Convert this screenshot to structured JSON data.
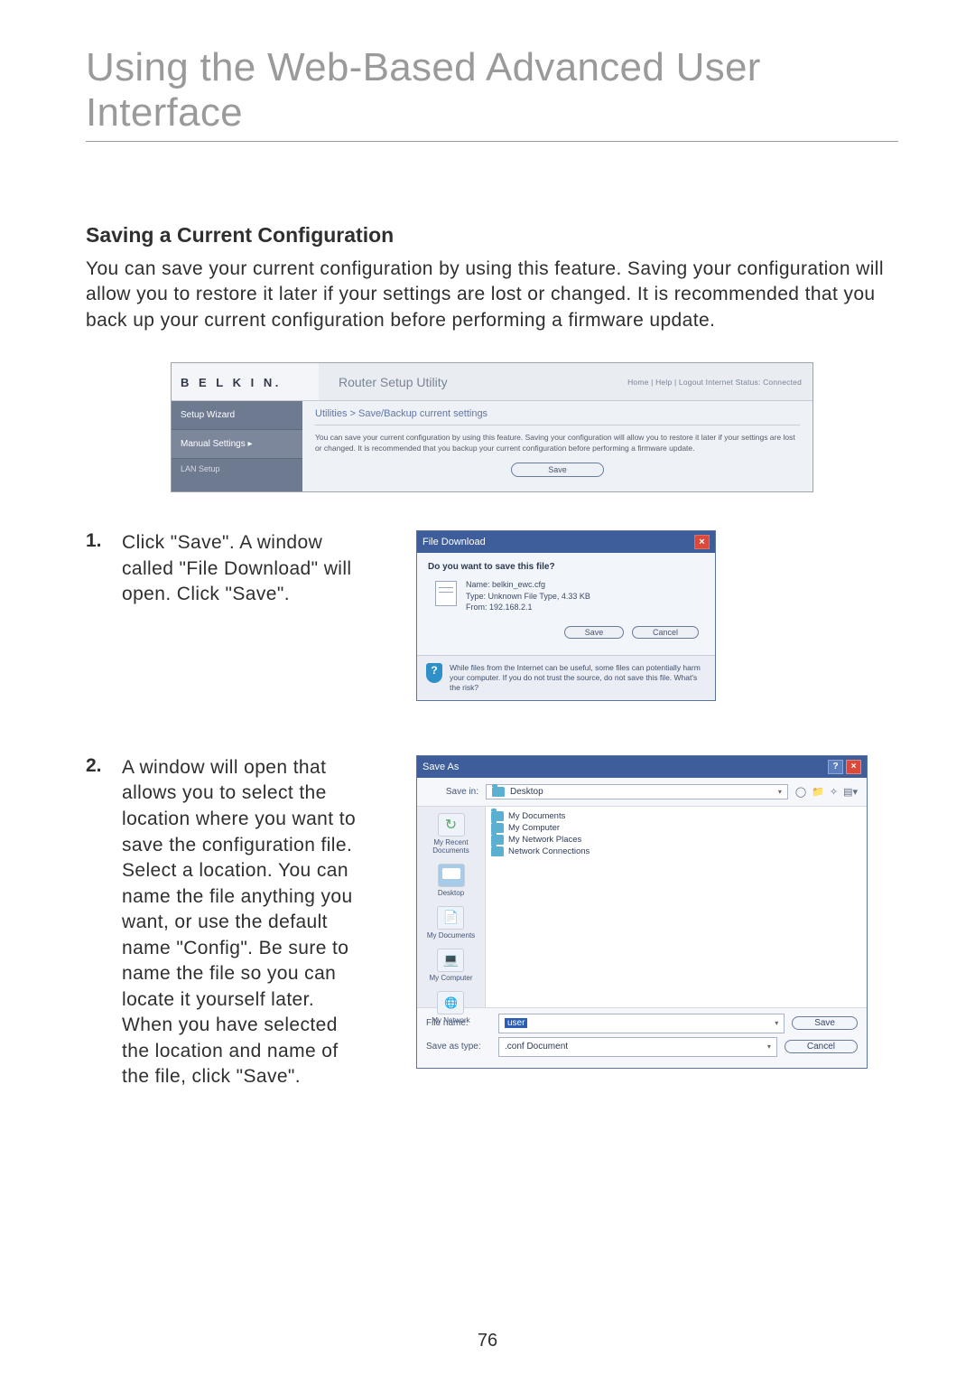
{
  "page": {
    "title": "Using the Web-Based Advanced User Interface",
    "number": "76"
  },
  "section": {
    "heading": "Saving a Current Configuration",
    "intro": "You can save your current configuration by using this feature. Saving your configuration will allow you to restore it later if your settings are lost or changed. It is recommended that you back up your current configuration before performing a firmware update."
  },
  "router": {
    "brand": "B E L K I N.",
    "utility_title": "Router Setup Utility",
    "nav_links": "Home | Help | Logout    Internet Status: Connected",
    "sidebar": {
      "wizard": "Setup Wizard",
      "manual": "Manual Settings ▸",
      "sub1": "LAN Setup"
    },
    "breadcrumb": "Utilities > Save/Backup current settings",
    "desc": "You can save your current configuration by using this feature. Saving your configuration will allow you to restore it later if your settings are lost or changed. It is recommended that you backup your current configuration before performing a firmware update.",
    "save_label": "Save"
  },
  "steps": [
    {
      "num": "1.",
      "text": "Click \"Save\". A window called \"File Download\" will open. Click \"Save\"."
    },
    {
      "num": "2.",
      "text": "A window will open that allows you to select the location where you want to save the configuration file. Select a location. You can name the file anything you want, or use the default name \"Config\". Be sure to name the file so you can locate it yourself later. When you have selected the location and name of the file, click \"Save\"."
    }
  ],
  "dlg_download": {
    "title": "File Download",
    "question": "Do you want to save this file?",
    "meta_name": "Name:  belkin_ewc.cfg",
    "meta_type": "Type:  Unknown File Type, 4.33 KB",
    "meta_from": "From:  192.168.2.1",
    "save": "Save",
    "cancel": "Cancel",
    "warn": "While files from the Internet can be useful, some files can potentially harm your computer. If you do not trust the source, do not save this file. What's the risk?"
  },
  "dlg_saveas": {
    "title": "Save As",
    "savein_label": "Save in:",
    "savein_value": "Desktop",
    "places": {
      "recent": "My Recent Documents",
      "desktop": "Desktop",
      "mydocs": "My Documents",
      "mycomp": "My Computer",
      "network": "My Network"
    },
    "list": [
      "My Documents",
      "My Computer",
      "My Network Places",
      "Network Connections"
    ],
    "filename_label": "File name:",
    "filename_value": "user",
    "type_label": "Save as type:",
    "type_value": ".conf Document",
    "save": "Save",
    "cancel": "Cancel"
  }
}
